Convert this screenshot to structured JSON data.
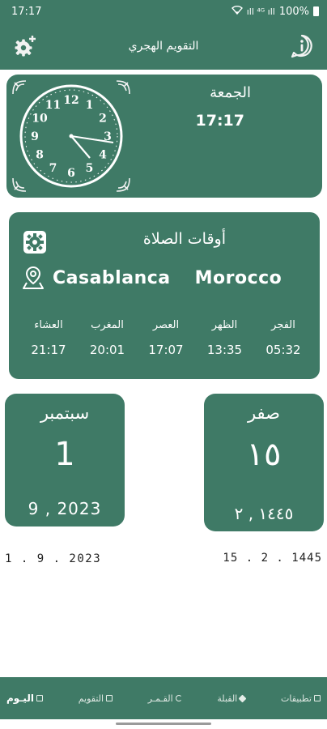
{
  "status_bar": {
    "time": "17:17",
    "signal": "ıll ⁴ᴳ ıll",
    "battery": "100%"
  },
  "app_bar": {
    "title": "التقويم الهجري",
    "settings_icon": "gear-plus-icon",
    "info_icon": "info-icon"
  },
  "clock_card": {
    "day_name": "الجمعة",
    "time": "17:17",
    "dial_numbers": [
      "12",
      "1",
      "2",
      "3",
      "4",
      "5",
      "6",
      "7",
      "8",
      "9",
      "10",
      "11"
    ]
  },
  "prayer_card": {
    "title": "أوقات الصلاة",
    "city": "Casablanca",
    "country": "Morocco",
    "prayers": [
      {
        "name": "العشاء",
        "time": "21:17"
      },
      {
        "name": "المغرب",
        "time": "20:01"
      },
      {
        "name": "العصر",
        "time": "17:07"
      },
      {
        "name": "الظهر",
        "time": "13:35"
      },
      {
        "name": "الفجر",
        "time": "05:32"
      }
    ]
  },
  "gregorian_card": {
    "month": "سبتمبر",
    "day": "1",
    "month_year": "9 , 2023"
  },
  "hijri_card": {
    "month": "صفر",
    "day": "١٥",
    "month_year": "١٤٤٥ , ٢"
  },
  "date_lines": {
    "gregorian": "1 . 9 . 2023",
    "hijri": "15 . 2 . 1445"
  },
  "bottom_nav": [
    {
      "label": "اليـوم",
      "icon": "calendar-icon",
      "active": true
    },
    {
      "label": "التقويم",
      "icon": "calendar-icon",
      "active": false
    },
    {
      "label": "القـمـر",
      "icon": "moon-icon",
      "active": false
    },
    {
      "label": "القبلة",
      "icon": "compass-icon",
      "active": false
    },
    {
      "label": "تطبيقات",
      "icon": "apps-icon",
      "active": false
    }
  ],
  "colors": {
    "primary": "#3f7a66",
    "text_on_primary": "#ffffff"
  }
}
